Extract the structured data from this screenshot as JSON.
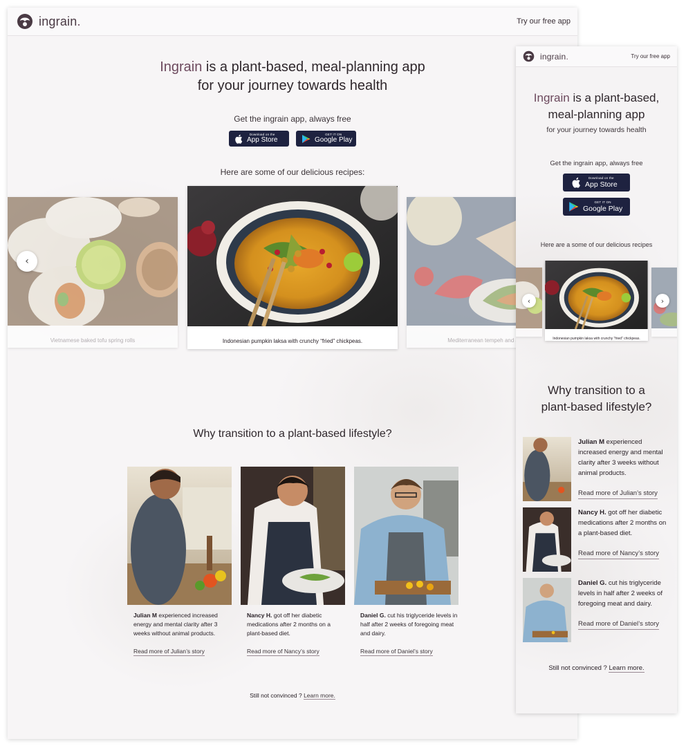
{
  "brand": {
    "name": "ingrain",
    "dot": "."
  },
  "header": {
    "try_link": "Try our free app"
  },
  "hero": {
    "accent_word": "Ingrain",
    "title_rest_line1": " is a plant-based, meal-planning app",
    "title_line2": "for your journey towards health",
    "get_app": "Get the ingrain app, always free"
  },
  "badges": {
    "appstore_small": "Download on the",
    "appstore_big": "App Store",
    "play_small": "GET IT ON",
    "play_big": "Google Play"
  },
  "recipes": {
    "intro_desktop": "Here are some of our delicious recipes:",
    "intro_mobile": "Here are a some of our delicious recipes",
    "items": [
      {
        "caption": "Vietnamese baked tofu spring rolls"
      },
      {
        "caption": "Indonesian pumpkin laksa with crunchy “fried” chickpeas."
      },
      {
        "caption": "Mediterranean tempeh and avocado"
      }
    ]
  },
  "why": {
    "title": "Why transition to a plant-based lifestyle?",
    "title_mobile_line1": "Why transition to a",
    "title_mobile_line2": "plant-based lifestyle?"
  },
  "stories": [
    {
      "name": "Julian M",
      "text": " experienced increased energy and mental clarity after 3 weeks without animal products.",
      "link": "Read more of Julian’s story"
    },
    {
      "name": "Nancy H.",
      "text": " got off her diabetic medications after 2 months on a plant-based diet.",
      "link": "Read more of Nancy’s story"
    },
    {
      "name": "Daniel G.",
      "text": " cut his triglyceride levels in half after 2 weeks of foregoing meat and dairy.",
      "link": "Read more of Daniel’s story"
    }
  ],
  "footer": {
    "still": "Still not convinced ? ",
    "learn": "Learn more."
  },
  "colors": {
    "accent": "#6d4a5e",
    "badge_bg": "#1e2240",
    "text": "#2a2228"
  },
  "icons": [
    "logo-icon",
    "apple-icon",
    "google-play-icon",
    "chevron-left-icon",
    "chevron-right-icon"
  ]
}
